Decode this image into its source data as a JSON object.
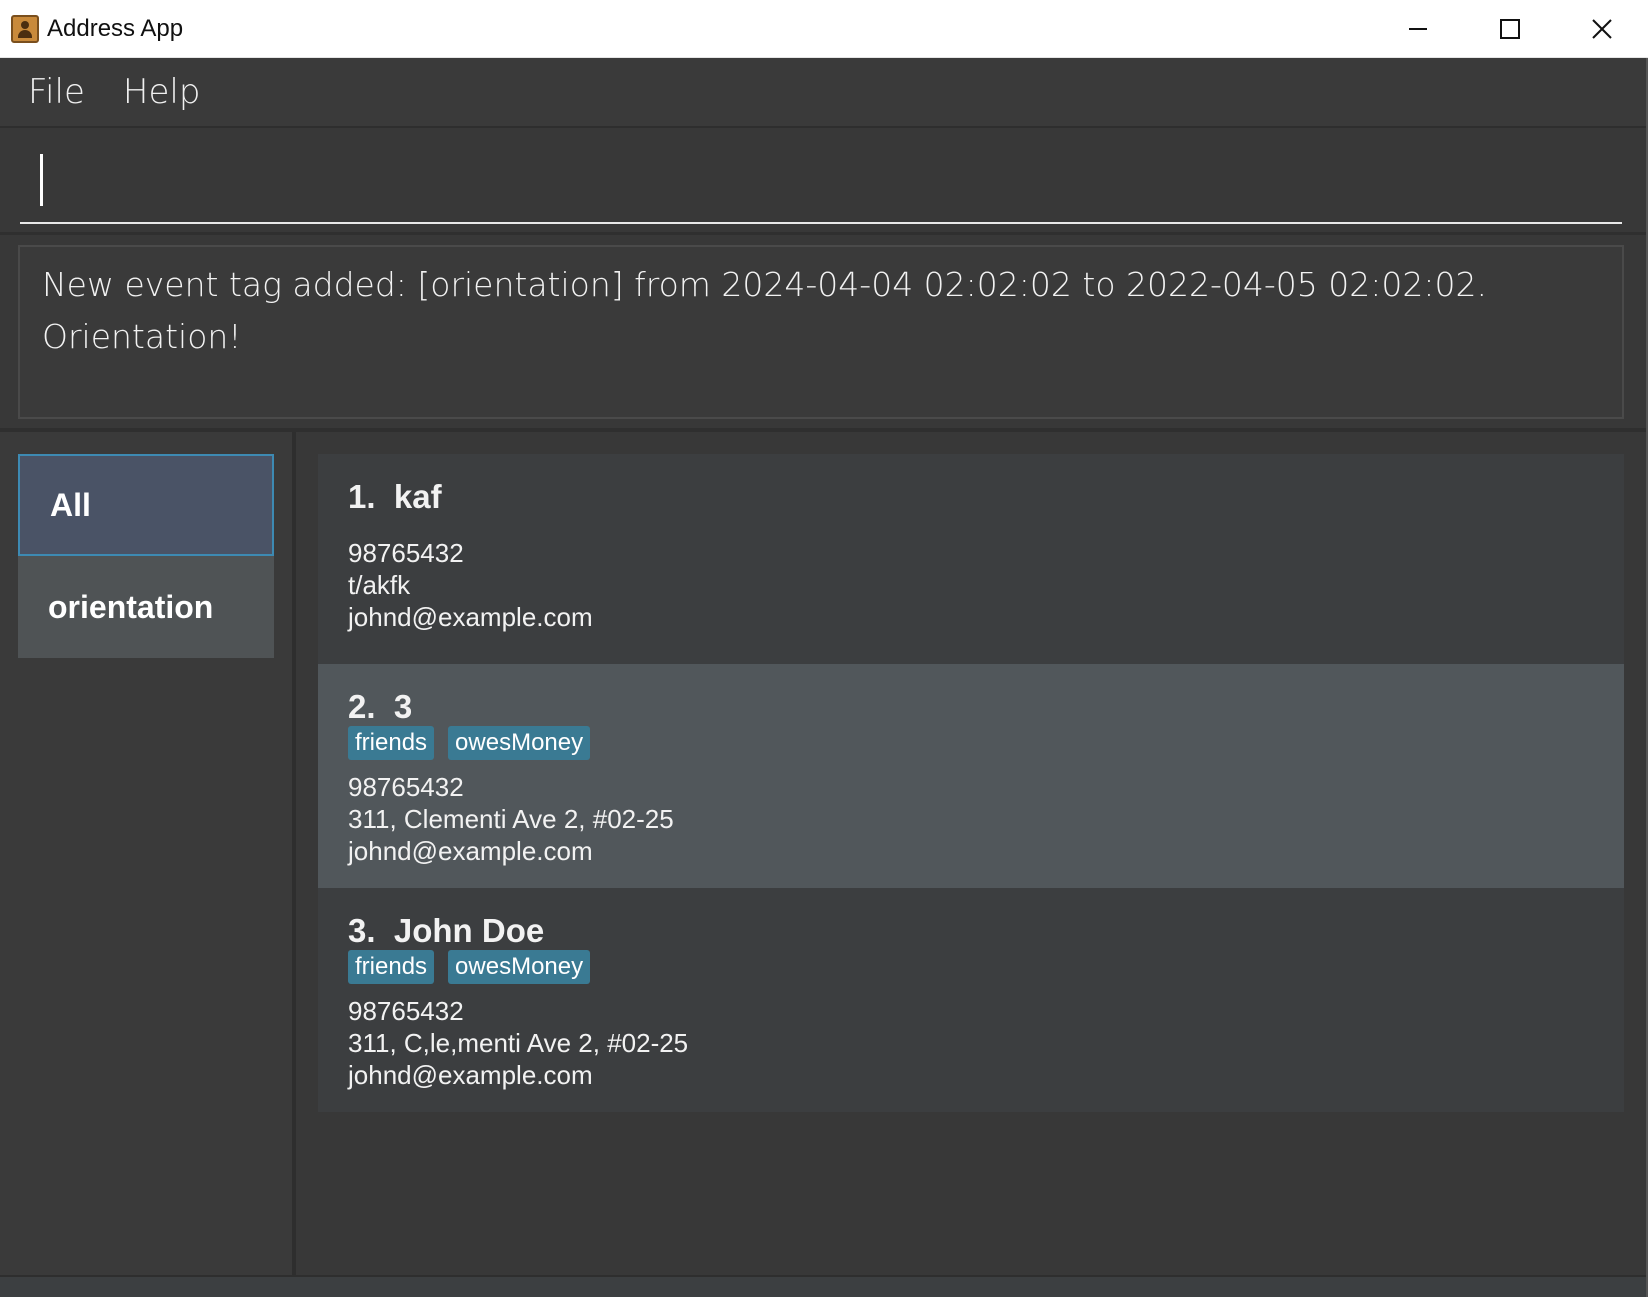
{
  "window": {
    "title": "Address App",
    "controls": {
      "minimize": "—",
      "maximize": "☐",
      "close": "✕"
    }
  },
  "menu": {
    "file": "File",
    "help": "Help"
  },
  "command": {
    "value": "",
    "placeholder": ""
  },
  "result": {
    "line1": "New event tag added: [orientation] from 2024-04-04 02:02:02 to 2022-04-05 02:02:02.",
    "line2": "Orientation!"
  },
  "filters": [
    {
      "label": "All",
      "selected": true
    },
    {
      "label": "orientation",
      "selected": false
    }
  ],
  "persons": [
    {
      "index": "1.",
      "name": "kaf",
      "tags": [],
      "phone": "98765432",
      "address": "t/akfk",
      "email": "johnd@example.com"
    },
    {
      "index": "2.",
      "name": "3",
      "tags": [
        "friends",
        "owesMoney"
      ],
      "phone": "98765432",
      "address": "311, Clementi Ave 2, #02-25",
      "email": "johnd@example.com"
    },
    {
      "index": "3.",
      "name": "John Doe",
      "tags": [
        "friends",
        "owesMoney"
      ],
      "phone": "98765432",
      "address": "311, C,le,menti Ave 2, #02-25",
      "email": "johnd@example.com"
    }
  ],
  "colors": {
    "background": "#383838",
    "tag": "#3a7a93",
    "selected_filter": "#4a5366",
    "selected_card": "#51575b"
  }
}
